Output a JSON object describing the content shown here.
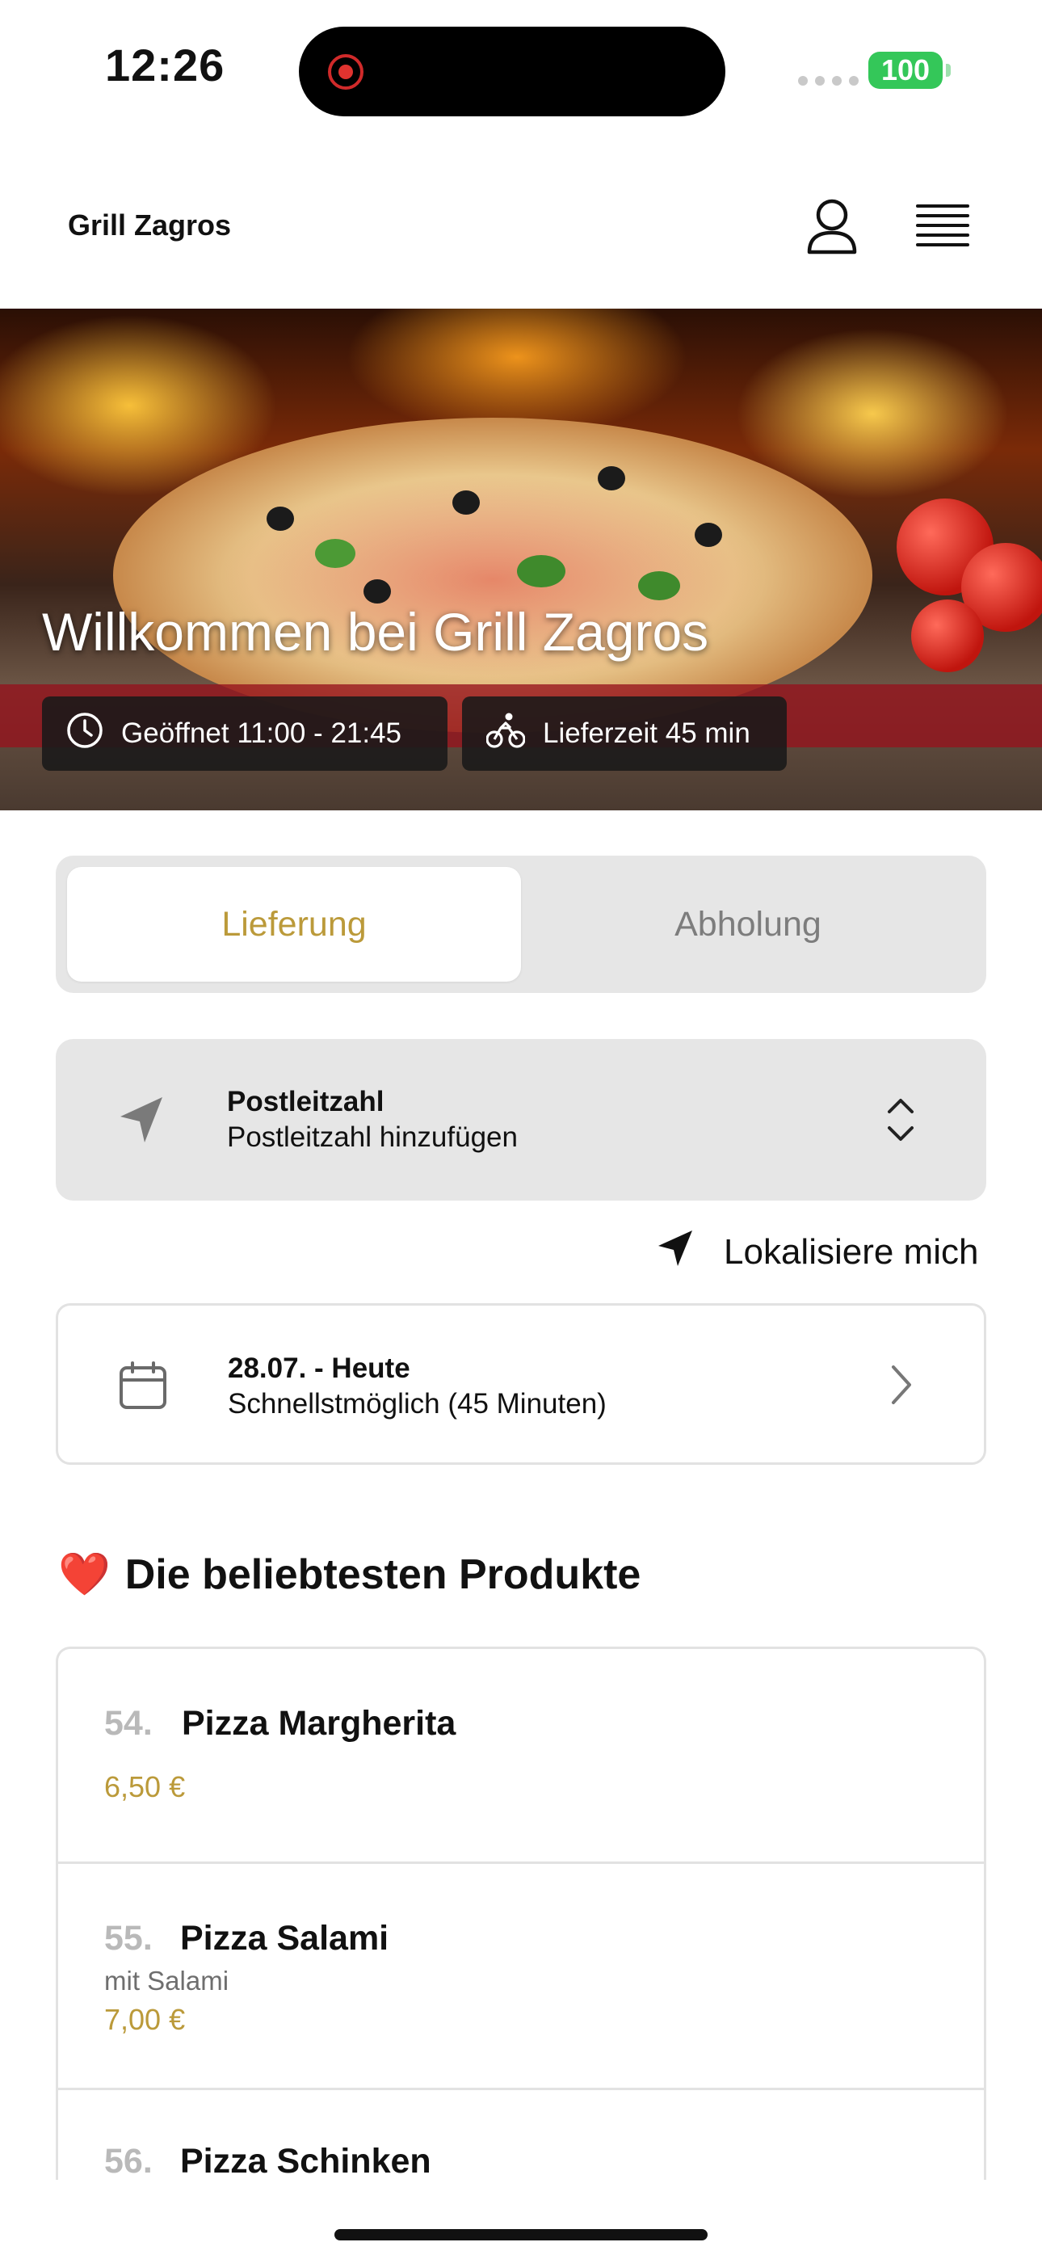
{
  "status_bar": {
    "time": "12:26",
    "battery": "100"
  },
  "header": {
    "brand": "Grill Zagros",
    "user_icon": "user-icon",
    "menu_icon": "hamburger-menu-icon"
  },
  "hero": {
    "title": "Willkommen bei Grill Zagros",
    "open_hours": "Geöffnet 11:00 - 21:45",
    "delivery_time": "Lieferzeit 45 min"
  },
  "mode_tabs": {
    "delivery": "Lieferung",
    "pickup": "Abholung",
    "selected": "Lieferung"
  },
  "postcode": {
    "title": "Postleitzahl",
    "placeholder": "Postleitzahl hinzufügen"
  },
  "locate": {
    "label": "Lokalisiere mich"
  },
  "date": {
    "title": "28.07. - Heute",
    "subtitle": "Schnellstmöglich (45 Minuten)"
  },
  "popular": {
    "emoji": "❤️",
    "title": "Die beliebtesten Produkte",
    "products": [
      {
        "number": "54.",
        "name": "Pizza Margherita",
        "description": "",
        "price": "6,50 €"
      },
      {
        "number": "55.",
        "name": "Pizza Salami",
        "description": "mit Salami",
        "price": "7,00 €"
      },
      {
        "number": "56.",
        "name": "Pizza Schinken",
        "description": "",
        "price": ""
      }
    ]
  },
  "colors": {
    "accent": "#bb9a3a",
    "battery": "#34c759",
    "band": "#96121c"
  }
}
